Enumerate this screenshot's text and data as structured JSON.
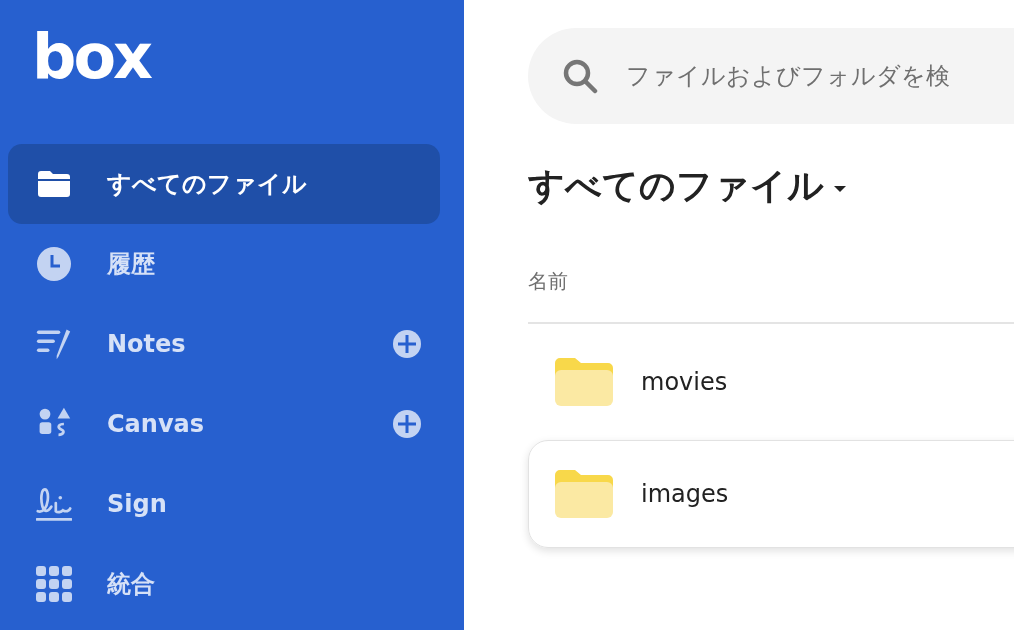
{
  "sidebar": {
    "logo": "box",
    "items": [
      {
        "kind": "folder",
        "label": "すべてのファイル",
        "selected": true,
        "add_button": false
      },
      {
        "kind": "clock",
        "label": "履歴",
        "selected": false,
        "add_button": false
      },
      {
        "kind": "notes",
        "label": "Notes",
        "selected": false,
        "add_button": true
      },
      {
        "kind": "canvas",
        "label": "Canvas",
        "selected": false,
        "add_button": true
      },
      {
        "kind": "sign",
        "label": "Sign",
        "selected": false,
        "add_button": false
      },
      {
        "kind": "apps",
        "label": "統合",
        "selected": false,
        "add_button": false
      }
    ]
  },
  "search": {
    "placeholder": "ファイルおよびフォルダを検"
  },
  "heading": "すべてのファイル",
  "table": {
    "columns": [
      "名前"
    ],
    "rows": [
      {
        "name": "movies",
        "selected": false
      },
      {
        "name": "images",
        "selected": true
      }
    ]
  }
}
